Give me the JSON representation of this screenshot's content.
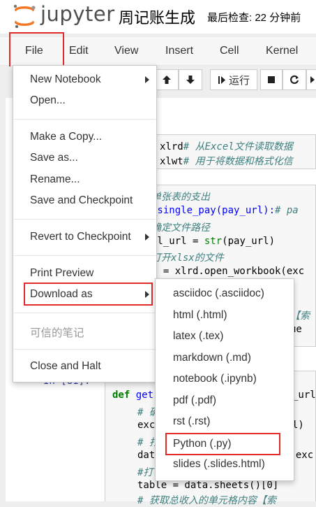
{
  "header": {
    "logo_text": "jupyter",
    "notebook_title": "周记账生成",
    "checkpoint": "最后检查: 22 分钟前"
  },
  "menubar": {
    "items": [
      "File",
      "Edit",
      "View",
      "Insert",
      "Cell",
      "Kernel"
    ]
  },
  "toolbar": {
    "run_label": "运行"
  },
  "file_menu": {
    "items": [
      {
        "label": "New Notebook",
        "submenu": true
      },
      {
        "label": "Open..."
      },
      {
        "label": "Make a Copy..."
      },
      {
        "label": "Save as..."
      },
      {
        "label": "Rename..."
      },
      {
        "label": "Save and Checkpoint"
      },
      {
        "label": "Revert to Checkpoint",
        "submenu": true
      },
      {
        "label": "Print Preview"
      },
      {
        "label": "Download as",
        "submenu": true,
        "highlighted": true
      },
      {
        "label": "可信的笔记",
        "disabled": true
      },
      {
        "label": "Close and Halt"
      }
    ]
  },
  "download_menu": {
    "items": [
      "asciidoc (.asciidoc)",
      "html (.html)",
      "latex (.tex)",
      "markdown (.md)",
      "notebook (.ipynb)",
      "pdf (.pdf)",
      "rst (.rst)",
      "Python (.py)",
      "slides (.slides.html)"
    ],
    "highlighted": "Python (.py)"
  },
  "code": {
    "line1_a": "xlrd",
    "line1_b": "# 从Excel文件读取数据",
    "line2_a": "xlwt",
    "line2_b": "# 用于将数据和格式化信",
    "c1": "单张表的支出",
    "l_def1": "_single_pay(pay_url):",
    "l_def1_c": "# pa",
    "c2": "确定文件路径",
    "l_url": "el_url = ",
    "l_url_f": "str",
    "l_url_r": "(pay_url)",
    "c3": "打开xlsx的文件",
    "l_data": "a = xlrd.open_workbook(exc",
    "c4": "【索",
    "l_due": "ue",
    "prompt": "In [81]:",
    "def2": "def",
    "def2_name": " get",
    "def2_rest": "_url]",
    "c5": "# 确",
    "l_exc": "exc",
    "l_exc_r": "l)",
    "c6": "# 打",
    "l_dat": "dat",
    "l_dat_r": "k(exc",
    "c7": "#打",
    "l_table": "table = data.sheets()[0]",
    "c8": "# 获取总收入的单元格内容【索"
  }
}
